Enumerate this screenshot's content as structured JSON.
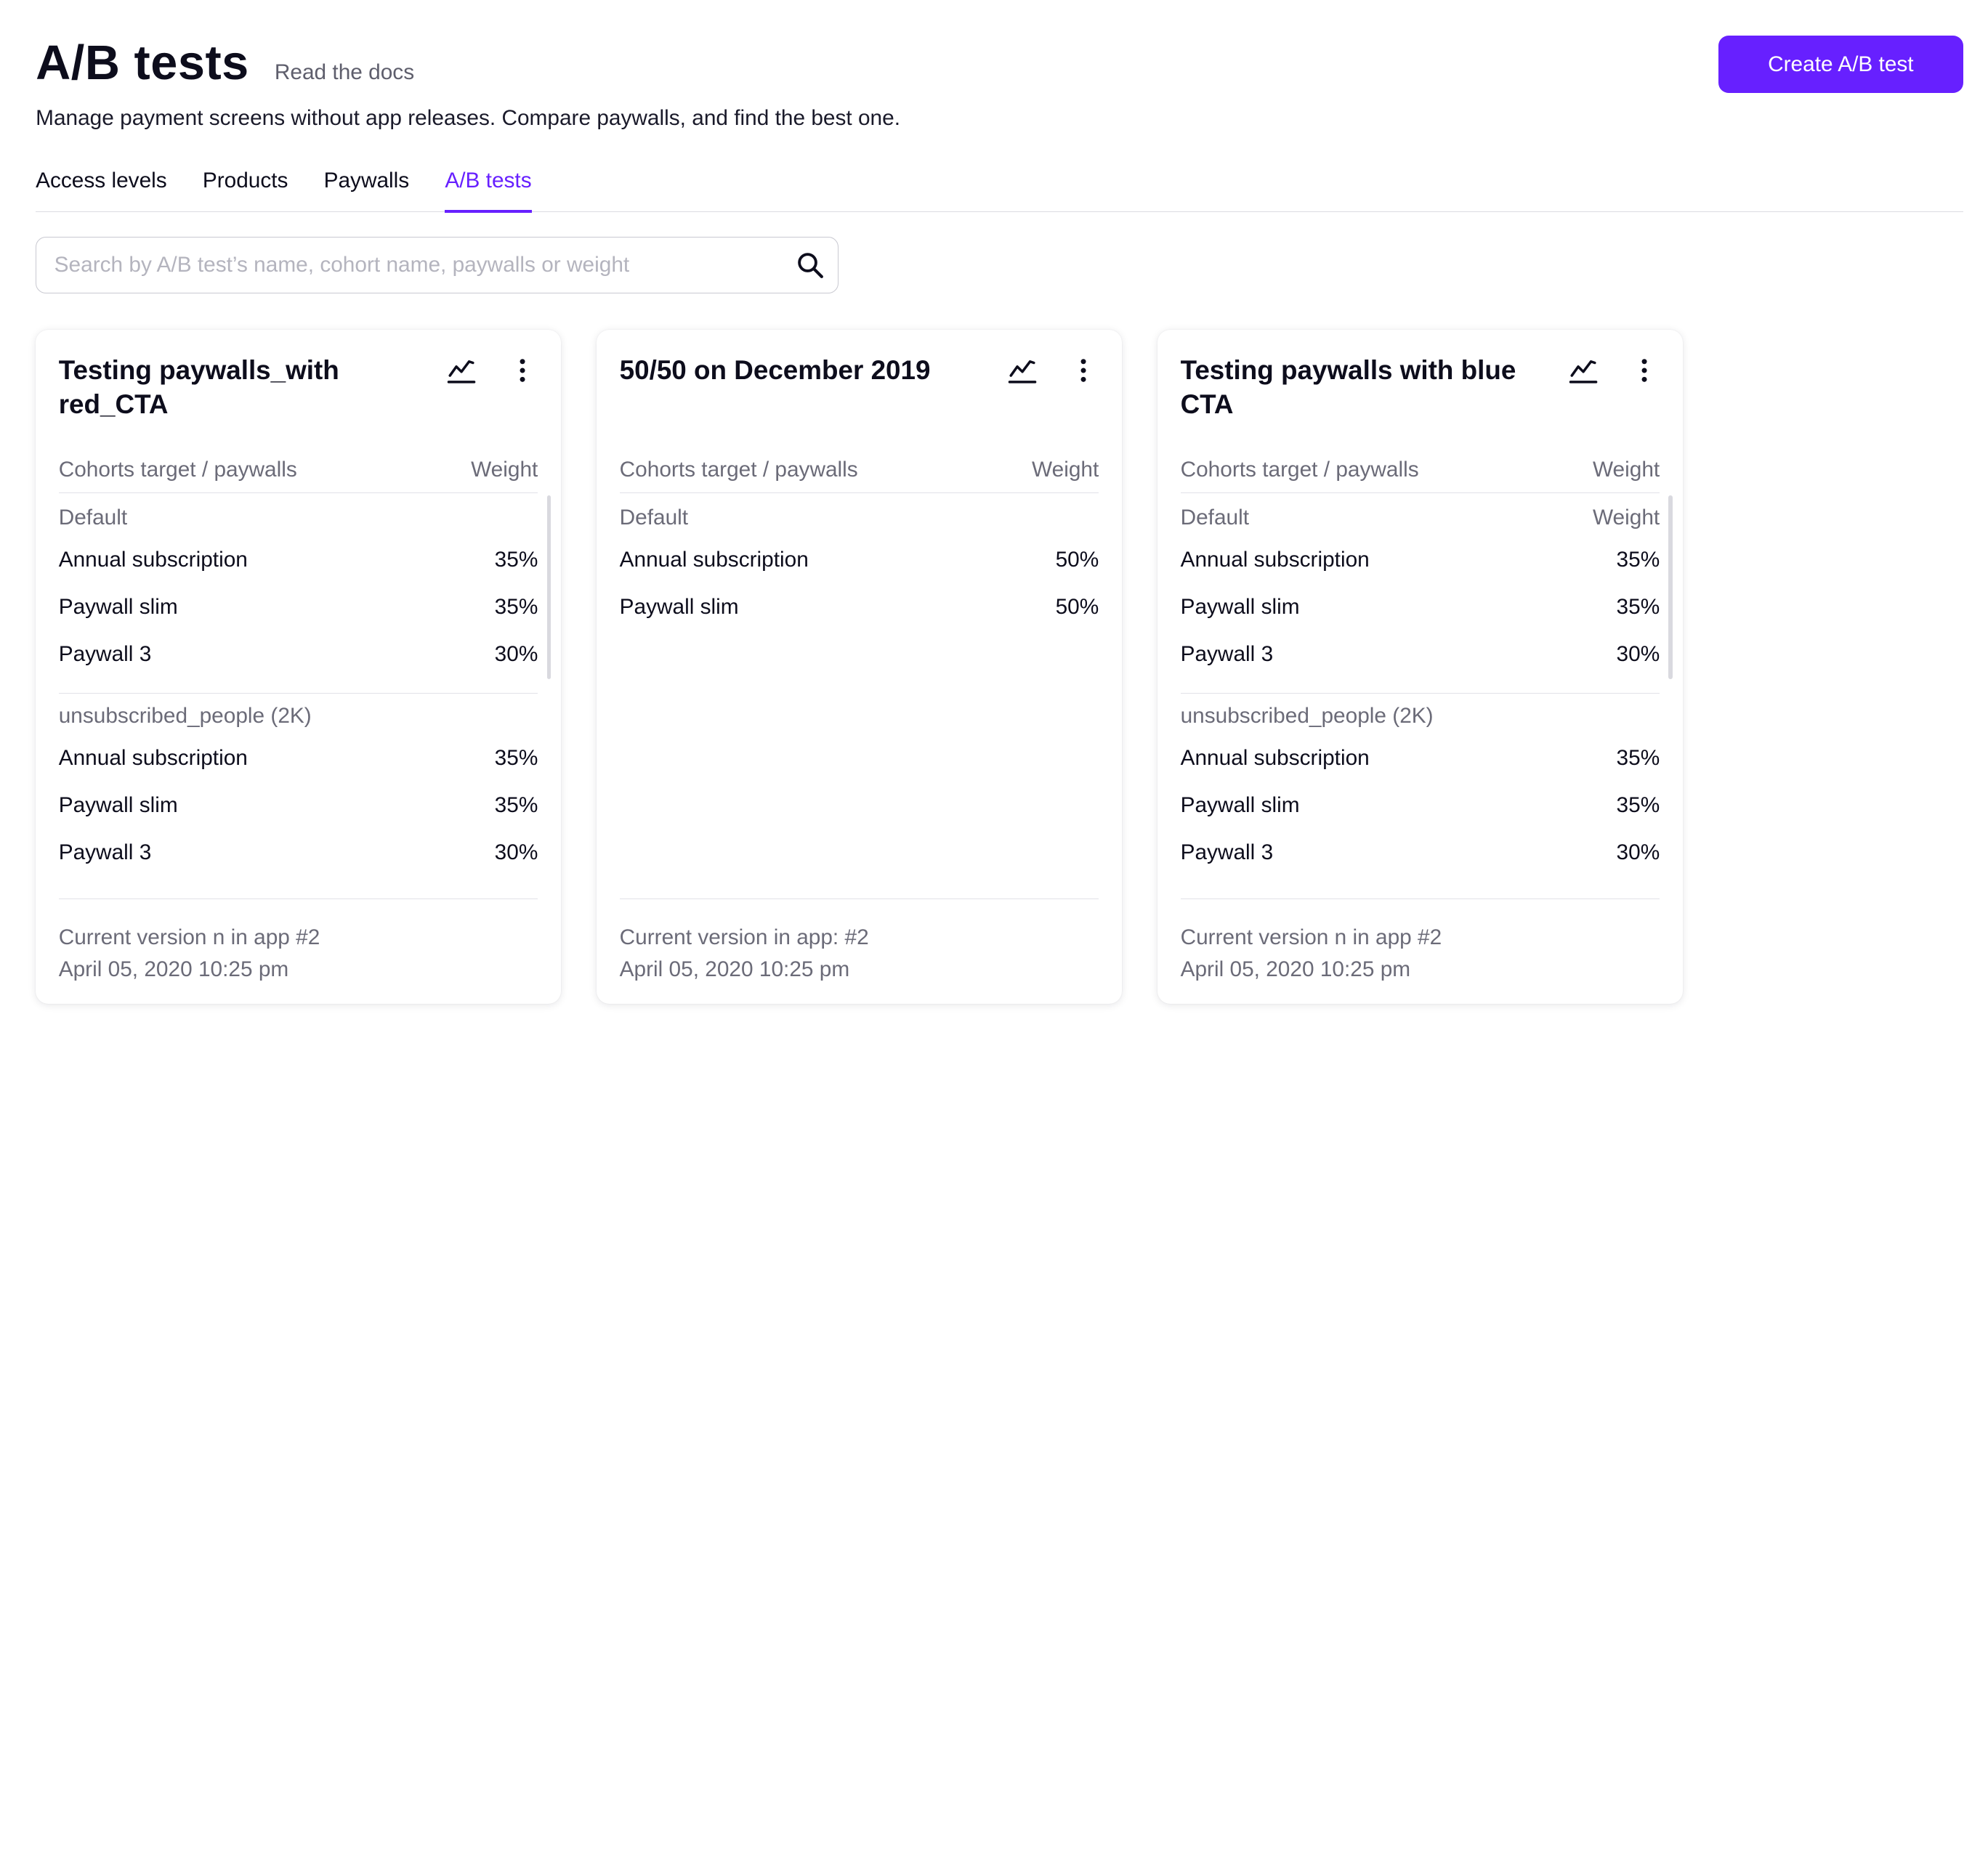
{
  "header": {
    "title": "A/B tests",
    "docs_link": "Read the docs",
    "subtitle": "Manage payment screens without app releases. Compare paywalls, and find the best one.",
    "create_button": "Create A/B test"
  },
  "tabs": [
    {
      "label": "Access levels",
      "active": false
    },
    {
      "label": "Products",
      "active": false
    },
    {
      "label": "Paywalls",
      "active": false
    },
    {
      "label": "A/B tests",
      "active": true
    }
  ],
  "search": {
    "placeholder": "Search by A/B test’s name, cohort name, paywalls or weight",
    "value": ""
  },
  "colors": {
    "accent": "#6720ff",
    "text": "#0d0d1c",
    "muted": "#6b6b78"
  },
  "icons": {
    "search": "search-icon",
    "chart": "line-chart-icon",
    "more": "more-vertical-icon"
  },
  "cards": [
    {
      "title": "Testing paywalls_with red_CTA",
      "col_left": "Cohorts target / paywalls",
      "col_right": "Weight",
      "cohorts": [
        {
          "name": "Default",
          "weight_label": "",
          "rows": [
            {
              "name": "Annual subscription",
              "weight": "35%"
            },
            {
              "name": "Paywall slim",
              "weight": "35%"
            },
            {
              "name": "Paywall 3",
              "weight": "30%"
            }
          ]
        },
        {
          "name": "unsubscribed_people (2K)",
          "weight_label": "",
          "rows": [
            {
              "name": "Annual subscription",
              "weight": "35%"
            },
            {
              "name": "Paywall slim",
              "weight": "35%"
            },
            {
              "name": "Paywall 3",
              "weight": "30%"
            }
          ]
        }
      ],
      "version": "Current version n in app #2",
      "date": "April 05, 2020 10:25 pm"
    },
    {
      "title": "50/50 on December 2019",
      "col_left": "Cohorts target / paywalls",
      "col_right": "Weight",
      "cohorts": [
        {
          "name": "Default",
          "weight_label": "",
          "rows": [
            {
              "name": "Annual subscription",
              "weight": "50%"
            },
            {
              "name": "Paywall slim",
              "weight": "50%"
            }
          ]
        }
      ],
      "version": "Current version in app: #2",
      "date": "April 05, 2020 10:25 pm"
    },
    {
      "title": "Testing paywalls with blue CTA",
      "col_left": "Cohorts target / paywalls",
      "col_right": "Weight",
      "cohorts": [
        {
          "name": "Default",
          "weight_label": "Weight",
          "rows": [
            {
              "name": "Annual subscription",
              "weight": "35%"
            },
            {
              "name": "Paywall slim",
              "weight": "35%"
            },
            {
              "name": "Paywall 3",
              "weight": "30%"
            }
          ]
        },
        {
          "name": "unsubscribed_people (2K)",
          "weight_label": "",
          "rows": [
            {
              "name": "Annual subscription",
              "weight": "35%"
            },
            {
              "name": "Paywall slim",
              "weight": "35%"
            },
            {
              "name": "Paywall 3",
              "weight": "30%"
            }
          ]
        }
      ],
      "version": "Current version n in app #2",
      "date": "April 05, 2020 10:25 pm"
    }
  ]
}
